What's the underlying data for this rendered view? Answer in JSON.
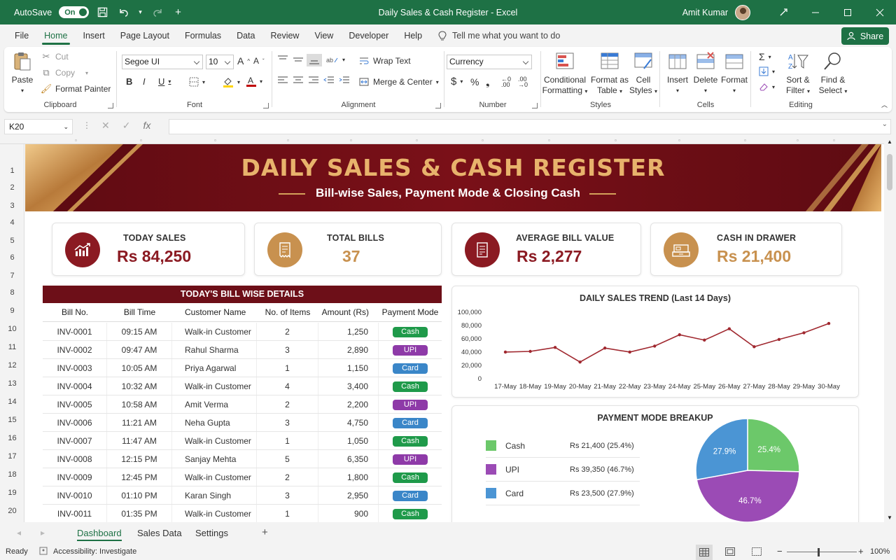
{
  "titlebar": {
    "autosave_label": "AutoSave",
    "autosave_state": "On",
    "title": "Daily Sales & Cash Register  -  Excel",
    "user": "Amit Kumar"
  },
  "menu": {
    "items": [
      "File",
      "Home",
      "Insert",
      "Page Layout",
      "Formulas",
      "Data",
      "Review",
      "View",
      "Developer",
      "Help"
    ],
    "active": "Home",
    "tell_me": "Tell me what you want to do",
    "share": "Share"
  },
  "ribbon": {
    "clipboard": {
      "paste": "Paste",
      "cut": "Cut",
      "copy": "Copy",
      "format_painter": "Format Painter",
      "label": "Clipboard"
    },
    "font": {
      "name": "Segoe UI",
      "size": "10",
      "label": "Font"
    },
    "alignment": {
      "wrap": "Wrap Text",
      "merge": "Merge & Center",
      "label": "Alignment"
    },
    "number": {
      "format": "Currency",
      "label": "Number"
    },
    "styles": {
      "conditional_1": "Conditional",
      "conditional_2": "Formatting",
      "format_table_1": "Format as",
      "format_table_2": "Table",
      "cell_styles_1": "Cell",
      "cell_styles_2": "Styles",
      "label": "Styles"
    },
    "cells": {
      "insert": "Insert",
      "delete": "Delete",
      "format": "Format",
      "label": "Cells"
    },
    "editing": {
      "sort_1": "Sort &",
      "sort_2": "Filter",
      "find_1": "Find &",
      "find_2": "Select",
      "label": "Editing"
    }
  },
  "formula_bar": {
    "name_box": "K20",
    "formula": ""
  },
  "rows": [
    "1",
    "2",
    "3",
    "4",
    "5",
    "6",
    "7",
    "8",
    "9",
    "10",
    "11",
    "12",
    "13",
    "14",
    "15",
    "16",
    "17",
    "18",
    "19",
    "20"
  ],
  "dashboard": {
    "title": "DAILY SALES & CASH REGISTER",
    "subtitle": "Bill-wise Sales, Payment Mode & Closing Cash",
    "kpis": [
      {
        "label": "TODAY SALES",
        "value": "Rs 84,250",
        "color": "#8b1a22",
        "icon": "chart-up-icon"
      },
      {
        "label": "TOTAL BILLS",
        "value": "37",
        "color": "#c8914f",
        "icon": "receipt-icon"
      },
      {
        "label": "AVERAGE BILL VALUE",
        "value": "Rs 2,277",
        "color": "#8b1a22",
        "icon": "bill-icon"
      },
      {
        "label": "CASH IN DRAWER",
        "value": "Rs 21,400",
        "color": "#c8914f",
        "icon": "cash-drawer-icon"
      }
    ],
    "table": {
      "title": "TODAY'S BILL WISE DETAILS",
      "columns": [
        "Bill No.",
        "Bill Time",
        "Customer Name",
        "No. of Items",
        "Amount (Rs)",
        "Payment Mode"
      ],
      "rows": [
        [
          "INV-0001",
          "09:15 AM",
          "Walk-in Customer",
          "2",
          "1,250",
          "Cash"
        ],
        [
          "INV-0002",
          "09:47 AM",
          "Rahul Sharma",
          "3",
          "2,890",
          "UPI"
        ],
        [
          "INV-0003",
          "10:05 AM",
          "Priya Agarwal",
          "1",
          "1,150",
          "Card"
        ],
        [
          "INV-0004",
          "10:32 AM",
          "Walk-in Customer",
          "4",
          "3,400",
          "Cash"
        ],
        [
          "INV-0005",
          "10:58 AM",
          "Amit Verma",
          "2",
          "2,200",
          "UPI"
        ],
        [
          "INV-0006",
          "11:21 AM",
          "Neha Gupta",
          "3",
          "4,750",
          "Card"
        ],
        [
          "INV-0007",
          "11:47 AM",
          "Walk-in Customer",
          "1",
          "1,050",
          "Cash"
        ],
        [
          "INV-0008",
          "12:15 PM",
          "Sanjay Mehta",
          "5",
          "6,350",
          "UPI"
        ],
        [
          "INV-0009",
          "12:45 PM",
          "Walk-in Customer",
          "2",
          "1,800",
          "Cash"
        ],
        [
          "INV-0010",
          "01:10 PM",
          "Karan Singh",
          "3",
          "2,950",
          "Card"
        ],
        [
          "INV-0011",
          "01:35 PM",
          "Walk-in Customer",
          "1",
          "900",
          "Cash"
        ]
      ],
      "mode_colors": {
        "Cash": "#1f9a4a",
        "UPI": "#8e3aa8",
        "Card": "#3a86c8"
      }
    },
    "trend": {
      "title": "DAILY SALES TREND (Last 14 Days)"
    },
    "payment": {
      "title": "PAYMENT MODE BREAKUP"
    }
  },
  "chart_data": [
    {
      "type": "line",
      "title": "DAILY SALES TREND (Last 14 Days)",
      "categories": [
        "17-May",
        "18-May",
        "19-May",
        "20-May",
        "21-May",
        "22-May",
        "23-May",
        "24-May",
        "25-May",
        "26-May",
        "27-May",
        "28-May",
        "29-May",
        "30-May"
      ],
      "values": [
        39000,
        40000,
        46000,
        24000,
        45000,
        39000,
        48000,
        65000,
        57000,
        74000,
        47000,
        58000,
        68000,
        82000
      ],
      "ylim": [
        0,
        100000
      ],
      "yticks": [
        "0",
        "20,000",
        "40,000",
        "60,000",
        "80,000",
        "100,000"
      ],
      "color": "#a0282f"
    },
    {
      "type": "pie",
      "title": "PAYMENT MODE BREAKUP",
      "labels": [
        "Cash",
        "UPI",
        "Card"
      ],
      "values": [
        25.4,
        46.7,
        27.9
      ],
      "data_labels": [
        "25.4%",
        "46.7%",
        "27.9%"
      ],
      "amounts": [
        "Rs 21,400 (25.4%)",
        "Rs 39,350 (46.7%)",
        "Rs 23,500 (27.9%)"
      ],
      "colors": [
        "#6cc86a",
        "#9b4bb5",
        "#4b95d4"
      ]
    }
  ],
  "sheet_tabs": [
    "Dashboard",
    "Sales Data",
    "Settings"
  ],
  "active_tab": "Dashboard",
  "status": {
    "ready": "Ready",
    "accessibility": "Accessibility: Investigate",
    "zoom": "100%"
  }
}
